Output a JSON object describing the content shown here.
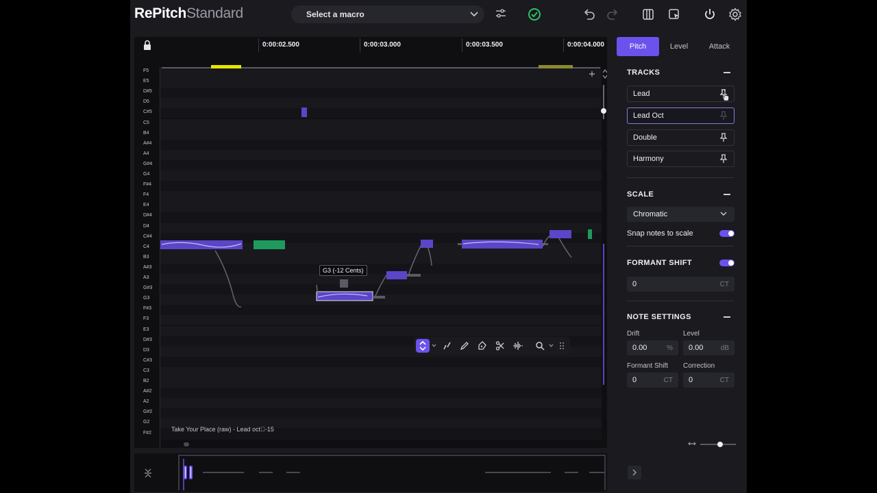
{
  "app": {
    "title_bold": "RePitch",
    "title_light": "Standard"
  },
  "header": {
    "macro_placeholder": "Select a macro"
  },
  "ruler": {
    "ticks": [
      "0:00:02.500",
      "0:00:03.000",
      "0:00:03.500",
      "0:00:04.000"
    ]
  },
  "piano_keys": [
    "F5",
    "E5",
    "D#5",
    "D5",
    "C#5",
    "C5",
    "B4",
    "A#4",
    "A4",
    "G#4",
    "G4",
    "F#4",
    "F4",
    "E4",
    "D#4",
    "D4",
    "C#4",
    "C4",
    "B3",
    "A#3",
    "A3",
    "G#3",
    "G3",
    "F#3",
    "F3",
    "E3",
    "D#3",
    "D3",
    "C#3",
    "C3",
    "B2",
    "A#2",
    "A2",
    "G#2",
    "G2",
    "F#2"
  ],
  "editor": {
    "tooltip": "G3 (-12 Cents)",
    "status": "Take Your Place (raw) - Lead oct\u0000-15"
  },
  "panel": {
    "tabs": [
      "Pitch",
      "Level",
      "Attack"
    ],
    "tracks_title": "TRACKS",
    "tracks": [
      "Lead",
      "Lead Oct",
      "Double",
      "Harmony"
    ],
    "scale_title": "SCALE",
    "scale_value": "Chromatic",
    "snap_label": "Snap notes to scale",
    "formant_title": "FORMANT SHIFT",
    "formant_value": "0",
    "formant_unit": "CT",
    "note_settings_title": "NOTE SETTINGS",
    "drift_label": "Drift",
    "drift_value": "0.00",
    "drift_unit": "%",
    "level_label": "Level",
    "level_value": "0.00",
    "level_unit": "dB",
    "fs_label": "Formant Shift",
    "fs_value": "0",
    "fs_unit": "CT",
    "correction_label": "Correction",
    "correction_value": "0",
    "correction_unit": "CT"
  },
  "colors": {
    "accent": "#6b52ec",
    "note_fill": "#5b45c8",
    "green_note": "#1e9a5e",
    "ok": "#2ec26b"
  }
}
